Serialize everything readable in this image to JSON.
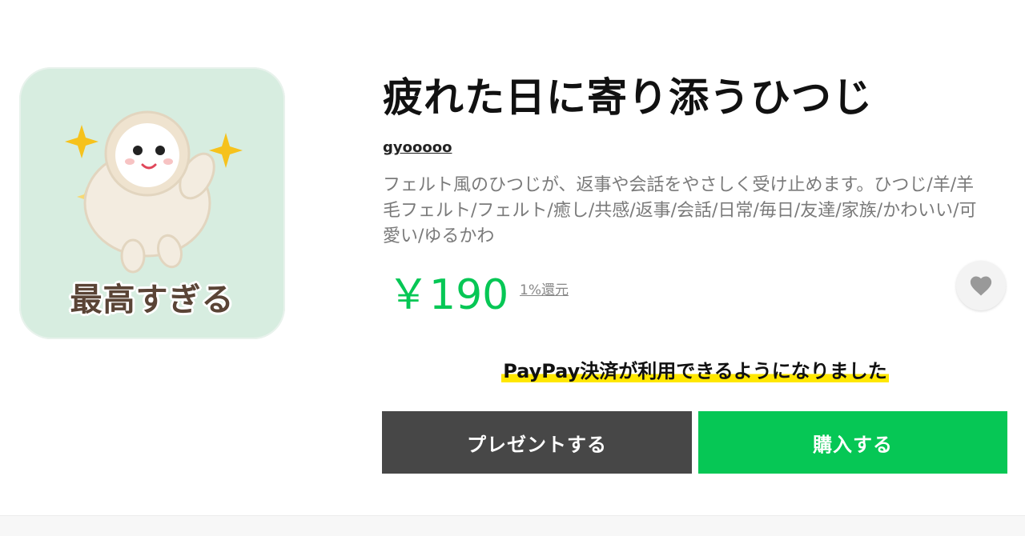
{
  "sticker": {
    "caption": "最高すぎる",
    "background_color": "#d7ede0"
  },
  "product": {
    "title": "疲れた日に寄り添うひつじ",
    "author": "gyooooo",
    "description": "フェルト風のひつじが、返事や会話をやさしく受け止めます。ひつじ/羊/羊毛フェルト/フェルト/癒し/共感/返事/会話/日常/毎日/友達/家族/かわいい/可愛い/ゆるかわ",
    "price": "￥190",
    "cashback": "1%還元",
    "price_color": "#06c755"
  },
  "favorite": {
    "icon": "heart-icon"
  },
  "notice": {
    "text": "PayPay決済が利用できるようになりました",
    "highlight_color": "#ffe700"
  },
  "actions": {
    "gift_label": "プレゼントする",
    "gift_color": "#474747",
    "buy_label": "購入する",
    "buy_color": "#06c755"
  }
}
